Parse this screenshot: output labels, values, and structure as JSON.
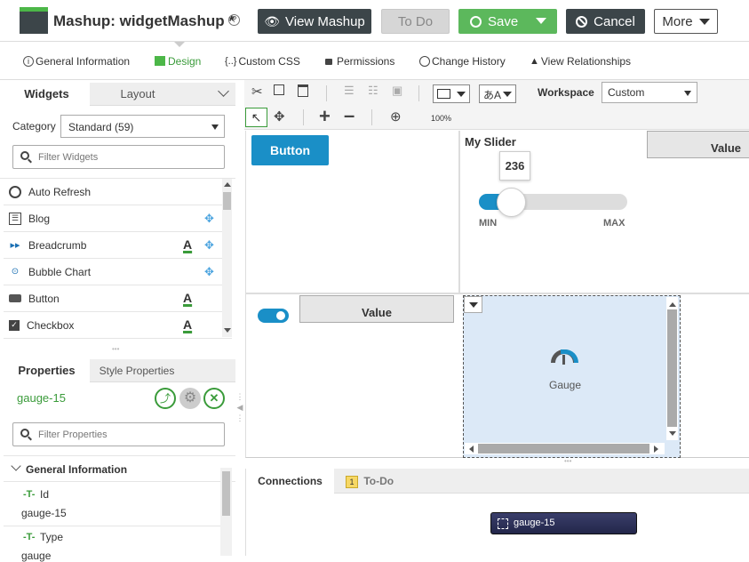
{
  "header": {
    "title": "Mashup: widgetMashup *",
    "help": "?",
    "view_mashup": "View Mashup",
    "todo": "To Do",
    "save": "Save",
    "cancel": "Cancel",
    "more": "More"
  },
  "tabs": [
    "General Information",
    "Design",
    "Custom CSS",
    "Permissions",
    "Change History",
    "View Relationships"
  ],
  "left": {
    "tab_widgets": "Widgets",
    "tab_layout": "Layout",
    "category_label": "Category",
    "category_value": "Standard (59)",
    "filter_widgets": "Filter Widgets",
    "widgets": [
      "Auto Refresh",
      "Blog",
      "Breadcrumb",
      "Bubble Chart",
      "Button",
      "Checkbox"
    ],
    "tab_properties": "Properties",
    "tab_style_properties": "Style Properties",
    "selected": "gauge-15",
    "filter_properties": "Filter Properties",
    "section_general": "General Information",
    "prop_id_label": "Id",
    "prop_id_value": "gauge-15",
    "prop_type_label": "Type",
    "prop_type_value": "gauge"
  },
  "toolbar": {
    "workspace_label": "Workspace",
    "workspace_value": "Custom",
    "zoom": "100%"
  },
  "canvas": {
    "button_label": "Button",
    "slider_title": "My Slider",
    "slider_value": "236",
    "slider_fraction": 0.22,
    "slider_min": "MIN",
    "slider_max": "MAX",
    "value_header_1": "Value",
    "value_header_2": "Value",
    "gauge_label": "Gauge"
  },
  "bottom": {
    "tab_connections": "Connections",
    "tab_todo": "To-Do",
    "todo_badge": "1",
    "node_label": "gauge-15"
  },
  "colors": {
    "accent_green": "#5cb85c",
    "dark_button": "#3c4549",
    "primary_blue": "#1a8fc7",
    "gauge_bg": "#dce9f7"
  }
}
